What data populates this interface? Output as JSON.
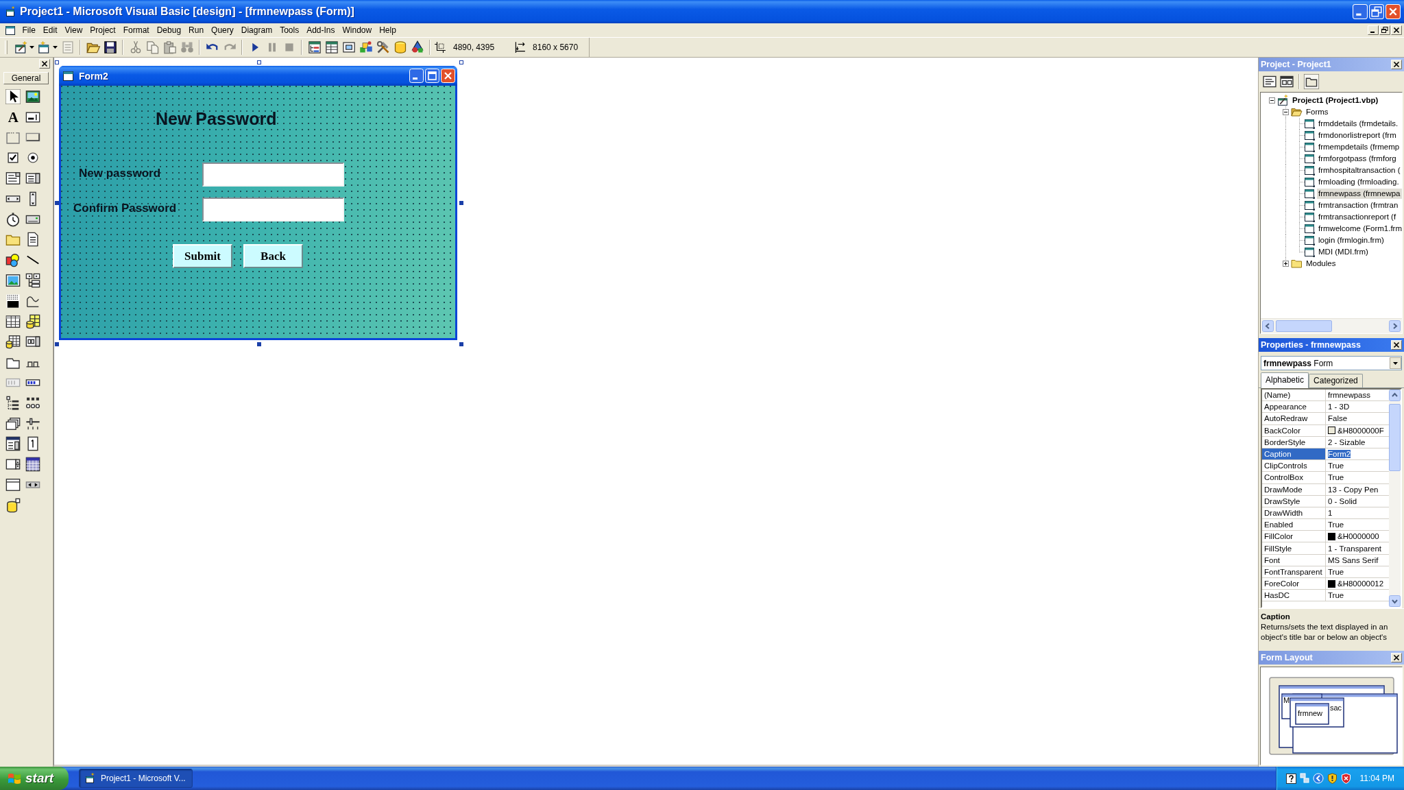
{
  "window": {
    "title": "Project1 - Microsoft Visual Basic [design] - [frmnewpass (Form)]"
  },
  "menu_bar": {
    "items": [
      "File",
      "Edit",
      "View",
      "Project",
      "Format",
      "Debug",
      "Run",
      "Query",
      "Diagram",
      "Tools",
      "Add-Ins",
      "Window",
      "Help"
    ]
  },
  "toolbar": {
    "groups": [
      {
        "buttons": [
          {
            "kind": "project",
            "disabled": false
          },
          {
            "kind": "form",
            "disabled": false
          },
          {
            "kind": "menus",
            "disabled": true
          }
        ]
      },
      {
        "buttons": [
          {
            "kind": "open",
            "disabled": false
          },
          {
            "kind": "save",
            "disabled": false
          }
        ]
      },
      {
        "buttons": [
          {
            "kind": "cut",
            "disabled": true
          },
          {
            "kind": "copy",
            "disabled": true
          },
          {
            "kind": "paste",
            "disabled": true
          },
          {
            "kind": "find",
            "disabled": true
          }
        ]
      },
      {
        "buttons": [
          {
            "kind": "undo",
            "disabled": false
          },
          {
            "kind": "redo",
            "disabled": true
          }
        ]
      },
      {
        "buttons": [
          {
            "kind": "start",
            "disabled": false
          },
          {
            "kind": "pause",
            "disabled": true
          },
          {
            "kind": "stop",
            "disabled": true
          }
        ]
      },
      {
        "buttons": [
          {
            "kind": "explorer",
            "disabled": false
          },
          {
            "kind": "properties",
            "disabled": false
          },
          {
            "kind": "layout",
            "disabled": false
          },
          {
            "kind": "browser",
            "disabled": false
          },
          {
            "kind": "toolbox",
            "disabled": false
          },
          {
            "kind": "dataview",
            "disabled": false
          },
          {
            "kind": "components",
            "disabled": false
          }
        ]
      }
    ],
    "position": "4890, 4395",
    "size": "8160 x 5670"
  },
  "toolbox": {
    "tab": "General",
    "tools": [
      {
        "kind": "pointer",
        "selected": true
      },
      {
        "kind": "picturebox",
        "selected": false
      },
      {
        "kind": "label",
        "glyph": "A",
        "selected": false
      },
      {
        "kind": "textbox",
        "selected": false
      },
      {
        "kind": "frame",
        "selected": false
      },
      {
        "kind": "commandbutton",
        "selected": false
      },
      {
        "kind": "checkbox",
        "selected": false
      },
      {
        "kind": "optionbutton",
        "selected": false
      },
      {
        "kind": "combobox",
        "selected": false
      },
      {
        "kind": "listbox",
        "selected": false
      },
      {
        "kind": "hscrollbar",
        "selected": false
      },
      {
        "kind": "vscrollbar",
        "selected": false
      },
      {
        "kind": "timer",
        "selected": false
      },
      {
        "kind": "drivelist",
        "selected": false
      },
      {
        "kind": "dirlist",
        "selected": false
      },
      {
        "kind": "filelist",
        "selected": false
      },
      {
        "kind": "shape",
        "selected": false
      },
      {
        "kind": "line",
        "selected": false
      },
      {
        "kind": "image",
        "selected": false
      },
      {
        "kind": "adodc",
        "selected": false
      },
      {
        "kind": "ole",
        "selected": false
      },
      {
        "kind": "curve",
        "selected": false
      },
      {
        "kind": "flexgrid",
        "selected": false
      },
      {
        "kind": "repeater",
        "selected": false
      },
      {
        "kind": "datagrid",
        "selected": false
      },
      {
        "kind": "dtpicker",
        "selected": false
      },
      {
        "kind": "tabpage",
        "selected": false
      },
      {
        "kind": "tabstrip",
        "selected": false
      },
      {
        "kind": "toolbar",
        "selected": false
      },
      {
        "kind": "progressbar",
        "selected": false
      },
      {
        "kind": "treeview",
        "selected": false
      },
      {
        "kind": "listview",
        "selected": false
      },
      {
        "kind": "imagelist",
        "selected": false
      },
      {
        "kind": "slider",
        "selected": false
      },
      {
        "kind": "coolbar",
        "selected": false
      },
      {
        "kind": "updown",
        "selected": false
      },
      {
        "kind": "spin",
        "selected": false
      },
      {
        "kind": "monthview",
        "selected": false
      },
      {
        "kind": "window",
        "selected": false
      },
      {
        "kind": "flatscroll",
        "selected": false
      },
      {
        "kind": "dataenv",
        "selected": false
      }
    ]
  },
  "form_designer": {
    "form": {
      "title": "Form2",
      "heading": "New Password",
      "fields": [
        {
          "label": "New password"
        },
        {
          "label": "Confirm Password"
        }
      ],
      "buttons": [
        "Submit",
        "Back"
      ]
    }
  },
  "project_explorer": {
    "title": "Project - Project1",
    "toolbar": [
      {
        "kind": "code",
        "on": false
      },
      {
        "kind": "object",
        "on": false
      },
      {
        "kind": "folders",
        "on": true
      }
    ],
    "tree": [
      {
        "label": "Project1 (Project1.vbp)",
        "kind": "project",
        "expanded": true,
        "selected": false,
        "children": [
          {
            "label": "Forms",
            "kind": "folder",
            "expanded": true,
            "selected": false,
            "children": [
              {
                "label": "frmddetails (frmdetails.",
                "kind": "form",
                "selected": false
              },
              {
                "label": "frmdonorlistreport (frm",
                "kind": "form",
                "selected": false
              },
              {
                "label": "frmempdetails (frmemp",
                "kind": "form",
                "selected": false
              },
              {
                "label": "frmforgotpass (frmforg",
                "kind": "form",
                "selected": false
              },
              {
                "label": "frmhospitaltransaction (",
                "kind": "form",
                "selected": false
              },
              {
                "label": "frmloading (frmloading.",
                "kind": "form",
                "selected": false
              },
              {
                "label": "frmnewpass (frmnewpa",
                "kind": "form",
                "selected": true
              },
              {
                "label": "frmtransaction (frmtran",
                "kind": "form",
                "selected": false
              },
              {
                "label": "frmtransactionreport (f",
                "kind": "form",
                "selected": false
              },
              {
                "label": "frmwelcome (Form1.frm",
                "kind": "form",
                "selected": false
              },
              {
                "label": "login (frmlogin.frm)",
                "kind": "form",
                "selected": false
              },
              {
                "label": "MDI (MDI.frm)",
                "kind": "form",
                "selected": false
              }
            ]
          },
          {
            "label": "Modules",
            "kind": "folder",
            "expanded": false,
            "selected": false
          }
        ]
      }
    ]
  },
  "properties": {
    "title": "Properties - frmnewpass",
    "object": "**frmnewpass** Form",
    "tabs": [
      {
        "label": "Alphabetic",
        "selected": true
      },
      {
        "label": "Categorized",
        "selected": false
      }
    ],
    "rows": [
      {
        "name": "(Name)",
        "value": "frmnewpass",
        "selected": false
      },
      {
        "name": "Appearance",
        "value": "1 - 3D",
        "selected": false
      },
      {
        "name": "AutoRedraw",
        "value": "False",
        "selected": false
      },
      {
        "name": "BackColor",
        "value": "&H8000000F",
        "color": "#ece9d8",
        "selected": false
      },
      {
        "name": "BorderStyle",
        "value": "2 - Sizable",
        "selected": false
      },
      {
        "name": "Caption",
        "value": "Form2",
        "selected": true
      },
      {
        "name": "ClipControls",
        "value": "True",
        "selected": false
      },
      {
        "name": "ControlBox",
        "value": "True",
        "selected": false
      },
      {
        "name": "DrawMode",
        "value": "13 - Copy Pen",
        "selected": false
      },
      {
        "name": "DrawStyle",
        "value": "0 - Solid",
        "selected": false
      },
      {
        "name": "DrawWidth",
        "value": "1",
        "selected": false
      },
      {
        "name": "Enabled",
        "value": "True",
        "selected": false
      },
      {
        "name": "FillColor",
        "value": "&H0000000",
        "color": "#000000",
        "selected": false
      },
      {
        "name": "FillStyle",
        "value": "1 - Transparent",
        "selected": false
      },
      {
        "name": "Font",
        "value": "MS Sans Serif",
        "selected": false
      },
      {
        "name": "FontTransparent",
        "value": "True",
        "selected": false
      },
      {
        "name": "ForeColor",
        "value": "&H80000012",
        "color": "#000000",
        "selected": false
      },
      {
        "name": "HasDC",
        "value": "True",
        "selected": false
      }
    ],
    "description": {
      "title": "Caption",
      "text": "Returns/sets the text displayed in an object's title bar or below an object's"
    }
  },
  "form_layout": {
    "title": "Form Layout",
    "windows": [
      {
        "title": "M"
      },
      {
        "title": "sac"
      },
      {
        "title": "frmnew"
      }
    ]
  },
  "taskbar": {
    "start": "start",
    "tasks": [
      {
        "label": "Project1 - Microsoft V...",
        "selected": true
      }
    ],
    "clock": "11:04 PM"
  }
}
